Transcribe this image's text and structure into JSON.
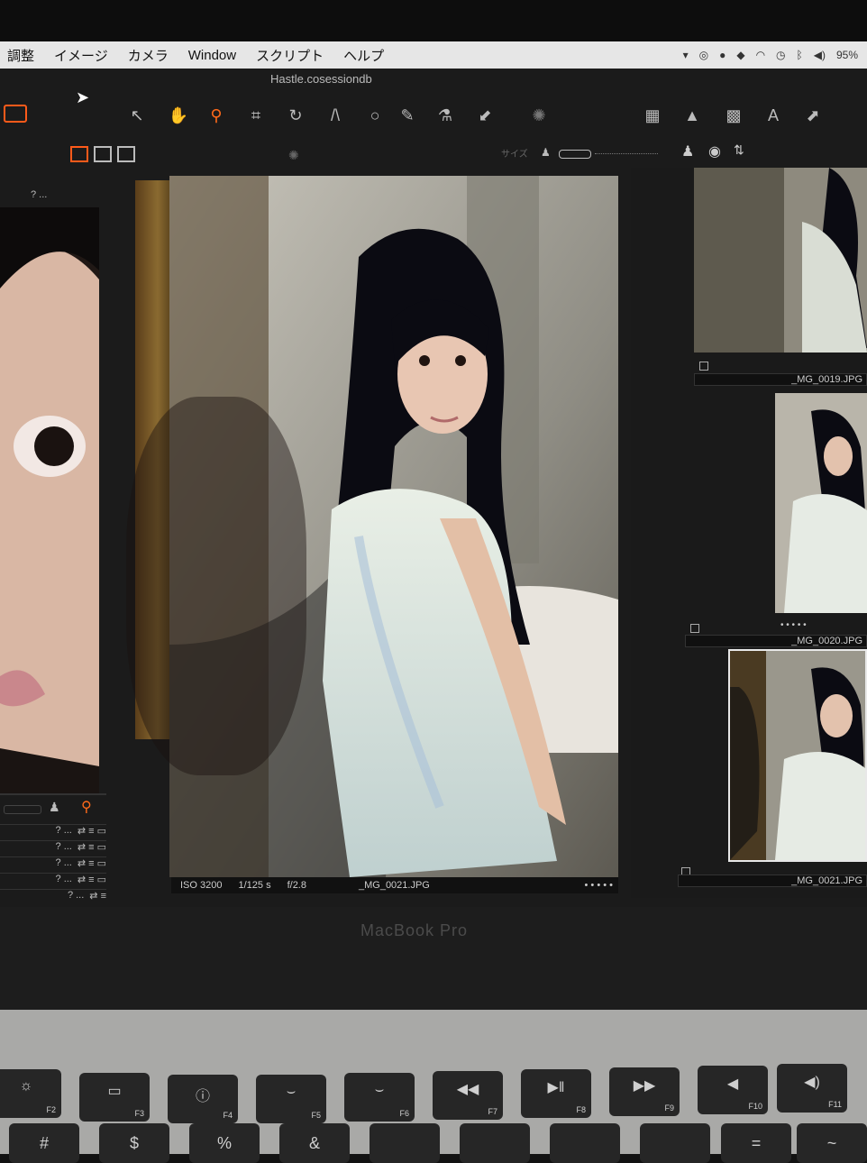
{
  "menubar": {
    "items": [
      "調整",
      "イメージ",
      "カメラ",
      "Window",
      "スクリプト",
      "ヘルプ"
    ],
    "battery": "95%"
  },
  "window": {
    "title": "Hastle.cosessiondb"
  },
  "toolbar": {
    "tools": [
      "pointer-icon",
      "hand-icon",
      "zoom-icon",
      "crop-icon",
      "rotate-icon",
      "keystone-icon",
      "circle-icon",
      "brush-icon",
      "picker-icon",
      "eraser-icon"
    ],
    "active_tool": "zoom-icon",
    "right_tools": [
      "grid-icon",
      "warning-icon",
      "crosshair-icon",
      "text-icon",
      "arrow-icon"
    ],
    "size_label": "サイズ"
  },
  "left_panel": {
    "rows": [
      "? ... ",
      "? ... ",
      "? ... ",
      "? ... ",
      "? ... "
    ]
  },
  "viewer": {
    "iso": "ISO 3200",
    "shutter": "1/125 s",
    "aperture": "f/2.8",
    "filename": "_MG_0021.JPG",
    "rating": "• • • • •"
  },
  "browser": {
    "thumbnails": [
      {
        "filename": "_MG_0019.JPG",
        "rating": "• • • • •"
      },
      {
        "filename": "_MG_0020.JPG",
        "rating": "• • • • •"
      },
      {
        "filename": "_MG_0021.JPG",
        "rating": "• • • • •"
      }
    ],
    "selected_index": 2
  },
  "laptop": {
    "brand": "MacBook Pro",
    "function_keys": [
      {
        "icon": "brightness-icon",
        "label": "F2"
      },
      {
        "icon": "mission-control-icon",
        "label": "F3"
      },
      {
        "icon": "info-icon",
        "label": "F4"
      },
      {
        "icon": "kbd-light-down-icon",
        "label": "F5"
      },
      {
        "icon": "kbd-light-up-icon",
        "label": "F6"
      },
      {
        "icon": "rewind-icon",
        "label": "F7"
      },
      {
        "icon": "play-pause-icon",
        "label": "F8"
      },
      {
        "icon": "fast-forward-icon",
        "label": "F9"
      },
      {
        "icon": "mute-icon",
        "label": "F10"
      },
      {
        "icon": "volume-icon",
        "label": "F11"
      }
    ],
    "number_keys": [
      "#",
      "$",
      "%",
      "&",
      "",
      "",
      "",
      "",
      "=",
      "~"
    ]
  },
  "colors": {
    "accent": "#ff6a1a",
    "menubar_bg": "#e6e6e6",
    "app_bg": "#1b1b1b"
  }
}
